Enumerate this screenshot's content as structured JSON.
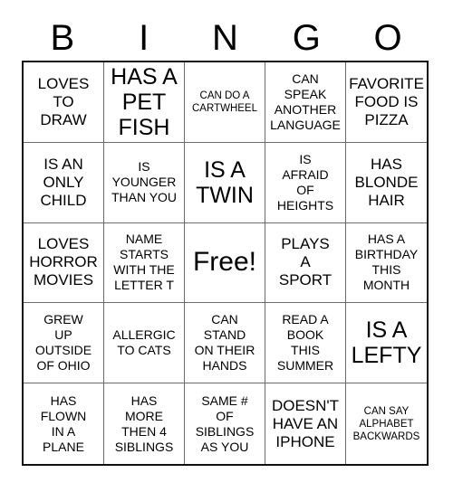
{
  "card": {
    "title_letters": [
      "B",
      "I",
      "N",
      "G",
      "O"
    ],
    "free_space_index": 12,
    "grid_size": 5,
    "colors": {
      "background": "#ffffff",
      "text": "#000000",
      "outer_border": "#111111",
      "inner_border": "#6b6b6b"
    },
    "cells": [
      {
        "text": "LOVES\nTO\nDRAW",
        "size": "md"
      },
      {
        "text": "HAS A\nPET\nFISH",
        "size": "lg"
      },
      {
        "text": "CAN DO A\nCARTWHEEL",
        "size": "xs"
      },
      {
        "text": "CAN\nSPEAK\nANOTHER\nLANGUAGE",
        "size": "sm"
      },
      {
        "text": "FAVORITE\nFOOD IS\nPIZZA",
        "size": "md"
      },
      {
        "text": "IS AN\nONLY\nCHILD",
        "size": "md"
      },
      {
        "text": "IS\nYOUNGER\nTHAN YOU",
        "size": "sm"
      },
      {
        "text": "IS A\nTWIN",
        "size": "lg"
      },
      {
        "text": "IS\nAFRAID\nOF\nHEIGHTS",
        "size": "sm"
      },
      {
        "text": "HAS\nBLONDE\nHAIR",
        "size": "md"
      },
      {
        "text": "LOVES\nHORROR\nMOVIES",
        "size": "md"
      },
      {
        "text": "NAME\nSTARTS\nWITH THE\nLETTER T",
        "size": "sm"
      },
      {
        "text": "Free!",
        "size": "xl"
      },
      {
        "text": "PLAYS\nA\nSPORT",
        "size": "md"
      },
      {
        "text": "HAS A\nBIRTHDAY\nTHIS\nMONTH",
        "size": "sm"
      },
      {
        "text": "GREW\nUP\nOUTSIDE\nOF OHIO",
        "size": "sm"
      },
      {
        "text": "ALLERGIC\nTO CATS",
        "size": "sm"
      },
      {
        "text": "CAN\nSTAND\nON THEIR\nHANDS",
        "size": "sm"
      },
      {
        "text": "READ A\nBOOK\nTHIS\nSUMMER",
        "size": "sm"
      },
      {
        "text": "IS A\nLEFTY",
        "size": "lg"
      },
      {
        "text": "HAS\nFLOWN\nIN A\nPLANE",
        "size": "sm"
      },
      {
        "text": "HAS\nMORE\nTHEN 4\nSIBLINGS",
        "size": "sm"
      },
      {
        "text": "SAME #\nOF\nSIBLINGS\nAS YOU",
        "size": "sm"
      },
      {
        "text": "DOESN'T\nHAVE AN\nIPHONE",
        "size": "md"
      },
      {
        "text": "CAN SAY\nALPHABET\nBACKWARDS",
        "size": "xs"
      }
    ]
  }
}
